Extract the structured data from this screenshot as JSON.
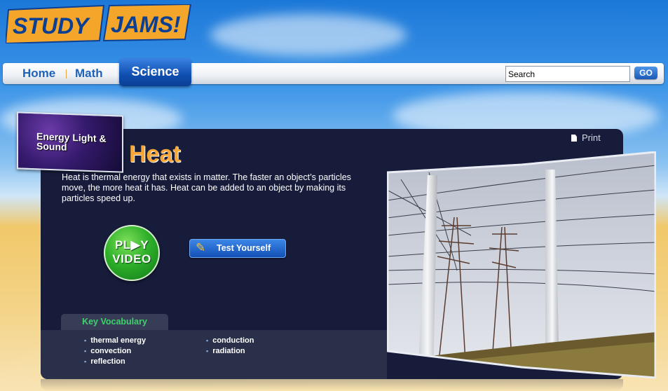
{
  "logo": {
    "word1": "STUDY",
    "word2": "JAMS!"
  },
  "nav": {
    "home": "Home",
    "math": "Math",
    "science": "Science"
  },
  "search": {
    "value": "Search",
    "go_label": "GO"
  },
  "topic": {
    "label": "Energy Light & Sound"
  },
  "print_label": "Print",
  "content": {
    "title": "Heat",
    "description": "Heat is thermal energy that exists in matter. The faster an object’s particles move, the more heat it has. Heat can be added to an object by making its particles speed up."
  },
  "play_video": {
    "line1": "PL▶Y",
    "line2": "VIDEO"
  },
  "test_yourself": "Test Yourself",
  "vocabulary": {
    "heading": "Key Vocabulary",
    "col1": [
      "thermal energy",
      "convection",
      "reflection"
    ],
    "col2": [
      "conduction",
      "radiation"
    ]
  },
  "colors": {
    "panel": "#171c3b",
    "title": "#f7a63a",
    "vocab_heading": "#3fd26a",
    "nav_text": "#1f63b8"
  }
}
